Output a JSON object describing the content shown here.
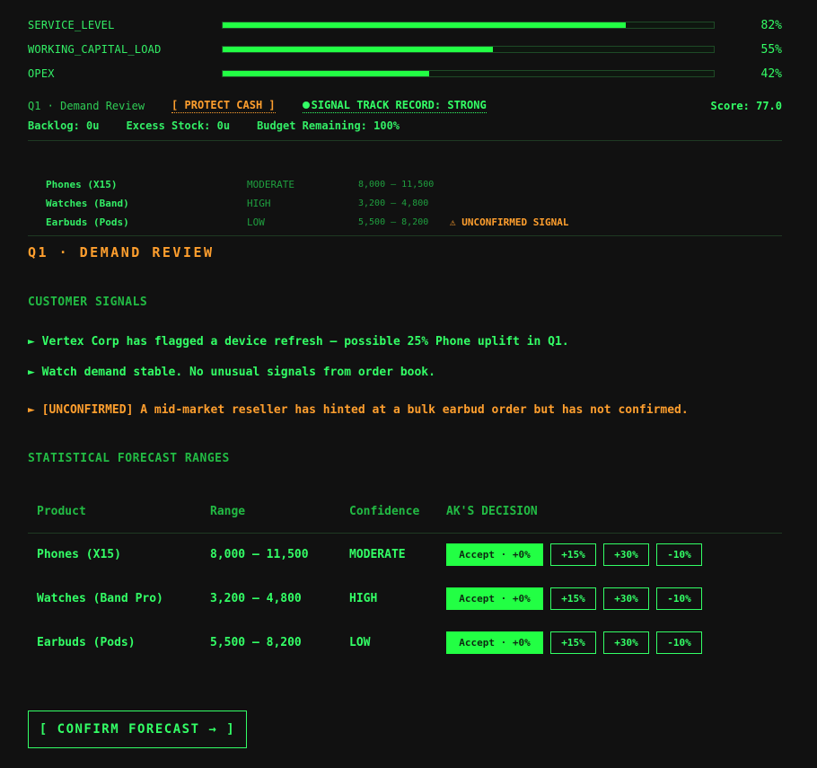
{
  "metrics": [
    {
      "label": "SERVICE_LEVEL",
      "value": 82,
      "display": "82%"
    },
    {
      "label": "WORKING_CAPITAL_LOAD",
      "value": 55,
      "display": "55%"
    },
    {
      "label": "OPEX",
      "value": 42,
      "display": "42%"
    }
  ],
  "status": {
    "quarter_label": "Q1 · Demand Review",
    "protect_label": "[ PROTECT CASH ]",
    "signal_track": "SIGNAL TRACK RECORD: STRONG",
    "score": "Score: 77.0"
  },
  "stats": {
    "backlog": "Backlog: 0u",
    "excess": "Excess Stock: 0u",
    "budget": "Budget Remaining: 100%"
  },
  "summary_table": [
    {
      "name": "Phones (X15)",
      "confidence": "MODERATE",
      "range": "8,000 – 11,500",
      "warning": ""
    },
    {
      "name": "Watches (Band)",
      "confidence": "HIGH",
      "range": "3,200 – 4,800",
      "warning": ""
    },
    {
      "name": "Earbuds (Pods)",
      "confidence": "LOW",
      "range": "5,500 – 8,200",
      "warning": "⚠ UNCONFIRMED SIGNAL"
    }
  ],
  "section_title": "Q1 · DEMAND REVIEW",
  "customer_signals": {
    "title": "CUSTOMER SIGNALS",
    "items": [
      "► Vertex Corp has flagged a device refresh — possible 25% Phone uplift in Q1.",
      "► Watch demand stable. No unusual signals from order book.",
      "► [UNCONFIRMED] A mid-market reseller has hinted at a bulk earbud order but has not confirmed."
    ]
  },
  "forecast": {
    "title": "STATISTICAL FORECAST RANGES",
    "headers": [
      "Product",
      "Range",
      "Confidence",
      "AK'S DECISION"
    ],
    "rows": [
      {
        "product": "Phones (X15)",
        "range": "8,000 – 11,500",
        "confidence": "MODERATE"
      },
      {
        "product": "Watches (Band Pro)",
        "range": "3,200 – 4,800",
        "confidence": "HIGH"
      },
      {
        "product": "Earbuds (Pods)",
        "range": "5,500 – 8,200",
        "confidence": "LOW"
      }
    ],
    "accept_label": "Accept · +0%",
    "adjust_labels": [
      "+15%",
      "+30%",
      "-10%"
    ]
  },
  "confirm_label": "[ CONFIRM FORECAST → ]"
}
